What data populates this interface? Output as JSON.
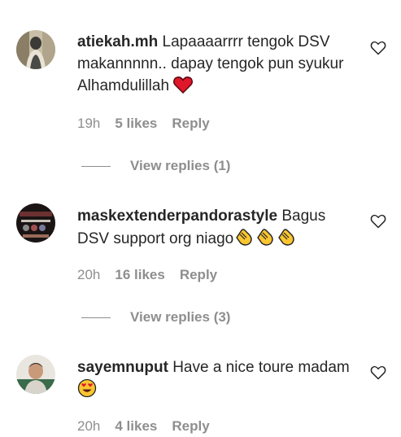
{
  "comments": [
    {
      "username": "atiekah.mh",
      "text": "Lapaaaarrrr tengok DSV makannnnn.. dapay tengok pun syukur Alhamdulillah",
      "emoji": "red-heart",
      "time": "19h",
      "likes": "5 likes",
      "reply_label": "Reply",
      "view_replies": "View replies (1)"
    },
    {
      "username": "maskextenderpandorastyle",
      "text": "Bagus DSV support org niago",
      "emoji": "clapping-hands x3",
      "time": "20h",
      "likes": "16 likes",
      "reply_label": "Reply",
      "view_replies": "View replies (3)"
    },
    {
      "username": "sayemnuput",
      "text": "Have a nice toure madam",
      "emoji": "heart-eyes-face",
      "time": "20h",
      "likes": "4 likes",
      "reply_label": "Reply"
    }
  ],
  "icons": {
    "like": "heart-outline-icon"
  },
  "colors": {
    "text": "#262626",
    "secondary": "#8e8e8e",
    "heart": "#ed4956"
  }
}
